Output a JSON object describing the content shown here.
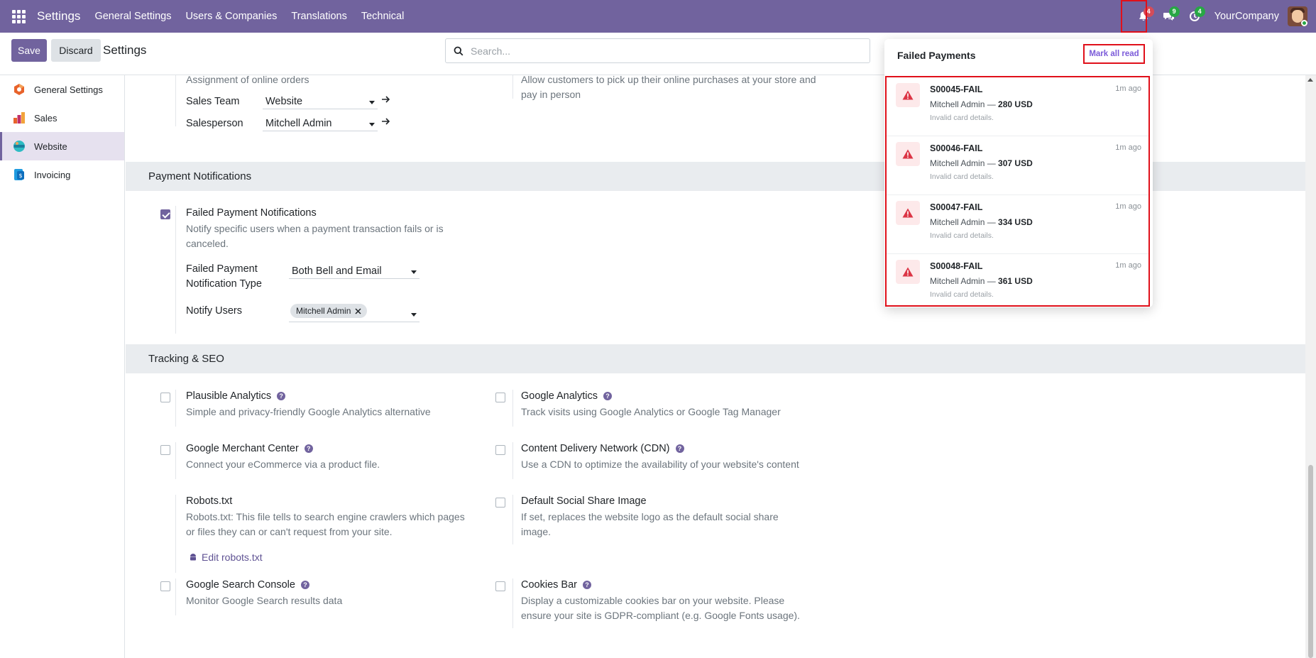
{
  "navbar": {
    "app_title": "Settings",
    "menu": [
      "General Settings",
      "Users & Companies",
      "Translations",
      "Technical"
    ],
    "bell_count": "4",
    "chat_count": "9",
    "activity_count": "4",
    "company": "YourCompany"
  },
  "control": {
    "save": "Save",
    "discard": "Discard",
    "title": "Settings",
    "search_placeholder": "Search..."
  },
  "sidebar": {
    "items": [
      {
        "label": "General Settings",
        "icon": "general-settings-icon",
        "color": "#e8632b"
      },
      {
        "label": "Sales",
        "icon": "sales-icon",
        "color": "#e8632b"
      },
      {
        "label": "Website",
        "icon": "website-icon",
        "color": "#2ebcc4",
        "active": true
      },
      {
        "label": "Invoicing",
        "icon": "invoicing-icon",
        "color": "#1f9be0"
      }
    ]
  },
  "top_section": {
    "assignment_text": "Assignment of online orders",
    "sales_team_label": "Sales Team",
    "sales_team_value": "Website",
    "salesperson_label": "Salesperson",
    "salesperson_value": "Mitchell Admin",
    "pickup_text": "Allow customers to pick up their online purchases at your store and pay in person"
  },
  "payment_notifications": {
    "header": "Payment Notifications",
    "setting_title": "Failed Payment Notifications",
    "setting_desc": "Notify specific users when a payment transaction fails or is canceled.",
    "type_label_1": "Failed Payment",
    "type_label_2": "Notification Type",
    "type_value": "Both Bell and Email",
    "notify_label": "Notify Users",
    "notify_tag": "Mitchell Admin",
    "checked": true
  },
  "tracking": {
    "header": "Tracking & SEO",
    "left": [
      {
        "title": "Plausible Analytics",
        "desc": "Simple and privacy-friendly Google Analytics alternative",
        "help": true
      },
      {
        "title": "Google Merchant Center",
        "desc": "Connect your eCommerce via a product file.",
        "help": true
      },
      {
        "title": "Robots.txt",
        "desc_1": "Robots.txt: This file tells to search engine crawlers which pages",
        "desc_2": "or files they can or can't request from your site.",
        "link": "Edit robots.txt"
      },
      {
        "title": "Google Search Console",
        "desc": "Monitor Google Search results data",
        "help": true
      }
    ],
    "right": [
      {
        "title": "Google Analytics",
        "desc": "Track visits using Google Analytics or Google Tag Manager",
        "help": true
      },
      {
        "title": "Content Delivery Network (CDN)",
        "desc": "Use a CDN to optimize the availability of your website's content",
        "help": true
      },
      {
        "title": "Default Social Share Image",
        "desc_1": "If set, replaces the website logo as the default social share",
        "desc_2": "image."
      },
      {
        "title": "Cookies Bar",
        "desc_1": "Display a customizable cookies bar on your website. Please",
        "desc_2": "ensure your site is GDPR-compliant (e.g. Google Fonts usage).",
        "help": true
      }
    ]
  },
  "notifications": {
    "title": "Failed Payments",
    "mark_all_read": "Mark all read",
    "items": [
      {
        "name": "S00045-FAIL",
        "time": "1m ago",
        "user": "Mitchell Admin —",
        "amount": "280 USD",
        "note": "Invalid card details."
      },
      {
        "name": "S00046-FAIL",
        "time": "1m ago",
        "user": "Mitchell Admin —",
        "amount": "307 USD",
        "note": "Invalid card details."
      },
      {
        "name": "S00047-FAIL",
        "time": "1m ago",
        "user": "Mitchell Admin —",
        "amount": "334 USD",
        "note": "Invalid card details."
      },
      {
        "name": "S00048-FAIL",
        "time": "1m ago",
        "user": "Mitchell Admin —",
        "amount": "361 USD",
        "note": "Invalid card details."
      }
    ]
  },
  "colors": {
    "brand": "#71639e",
    "alert": "#e0101a",
    "link": "#7b5bd9"
  }
}
